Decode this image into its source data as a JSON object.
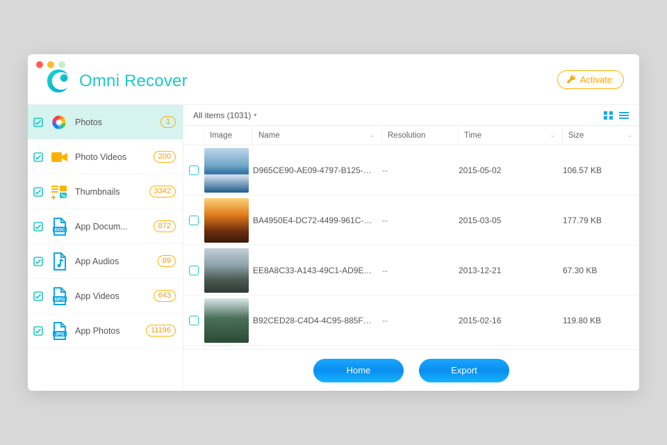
{
  "brand": {
    "name": "Omni Recover"
  },
  "header": {
    "activate_label": "Activate"
  },
  "sidebar": {
    "items": [
      {
        "label": "Photos",
        "count": "1",
        "icon": "photos"
      },
      {
        "label": "Photo Videos",
        "count": "200",
        "icon": "photo-videos"
      },
      {
        "label": "Thumbnails",
        "count": "3342",
        "icon": "thumbnails"
      },
      {
        "label": "App Docum...",
        "count": "872",
        "icon": "app-documents"
      },
      {
        "label": "App Audios",
        "count": "69",
        "icon": "app-audios"
      },
      {
        "label": "App Videos",
        "count": "643",
        "icon": "app-videos"
      },
      {
        "label": "App Photos",
        "count": "11196",
        "icon": "app-photos"
      }
    ]
  },
  "toolbar": {
    "all_items_label": "All items (1031)"
  },
  "columns": {
    "image": "Image",
    "name": "Name",
    "resolution": "Resolution",
    "time": "Time",
    "size": "Size"
  },
  "rows": [
    {
      "name": "D965CE90-AE09-4797-B125-C5...",
      "resolution": "--",
      "time": "2015-05-02",
      "size": "106.57 KB",
      "thumb": "th-coast"
    },
    {
      "name": "BA4950E4-DC72-4499-961C-32...",
      "resolution": "--",
      "time": "2015-03-05",
      "size": "177.79 KB",
      "thumb": "th-forest"
    },
    {
      "name": "EE8A8C33-A143-49C1-AD9E-D...",
      "resolution": "--",
      "time": "2013-12-21",
      "size": "67.30 KB",
      "thumb": "th-mount"
    },
    {
      "name": "B92CED28-C4D4-4C95-885F-F...",
      "resolution": "--",
      "time": "2015-02-16",
      "size": "119.80 KB",
      "thumb": "th-green"
    }
  ],
  "footer": {
    "home_label": "Home",
    "export_label": "Export"
  }
}
